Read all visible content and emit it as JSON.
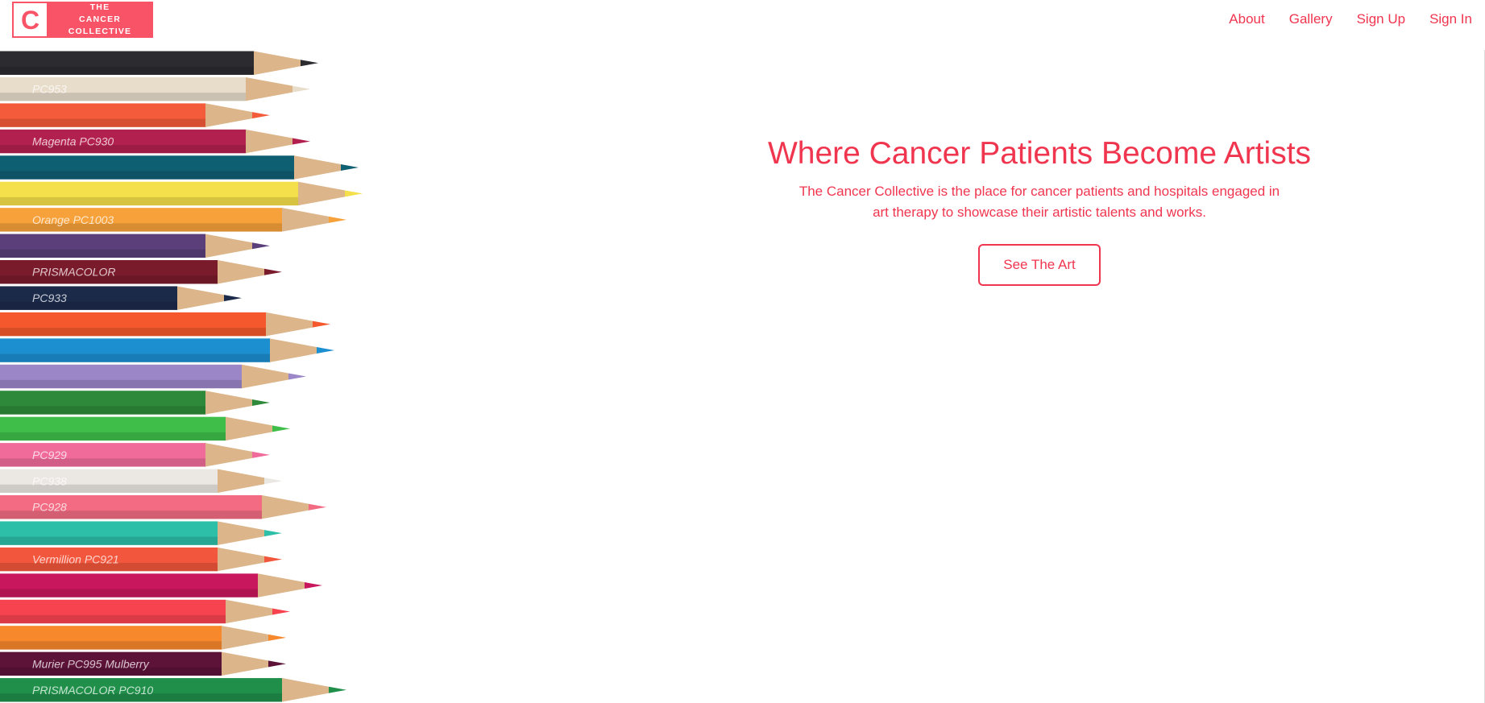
{
  "brand": {
    "mark": "C",
    "line1": "THE",
    "line2": "CANCER COLLECTIVE",
    "primary_color": "#f85367",
    "text_color": "#f0354f"
  },
  "nav": {
    "items": [
      {
        "label": "About"
      },
      {
        "label": "Gallery"
      },
      {
        "label": "Sign Up"
      },
      {
        "label": "Sign In"
      }
    ]
  },
  "hero": {
    "title": "Where Cancer Patients Become Artists",
    "subtitle": "The Cancer Collective is the place for cancer patients and hospitals engaged in art therapy to showcase their artistic talents and works.",
    "cta_label": "See The Art"
  },
  "pencils": {
    "image_icon": "colored-pencils-image",
    "items": [
      {
        "color": "#2b2b30",
        "label": ""
      },
      {
        "color": "#e8dccb",
        "label": "PC953"
      },
      {
        "color": "#f45b3a",
        "label": ""
      },
      {
        "color": "#b2204f",
        "label": "Magenta PC930"
      },
      {
        "color": "#0f5f73",
        "label": ""
      },
      {
        "color": "#f4e04a",
        "label": ""
      },
      {
        "color": "#f6a13a",
        "label": "Orange PC1003"
      },
      {
        "color": "#5b3f7a",
        "label": ""
      },
      {
        "color": "#7a1b2c",
        "label": "PRISMACOLOR"
      },
      {
        "color": "#1c2a4a",
        "label": "PC933"
      },
      {
        "color": "#f5582c",
        "label": ""
      },
      {
        "color": "#1c8fd0",
        "label": ""
      },
      {
        "color": "#9b86c8",
        "label": ""
      },
      {
        "color": "#2e8a3a",
        "label": ""
      },
      {
        "color": "#3fbf4a",
        "label": ""
      },
      {
        "color": "#f06b9a",
        "label": "PC929"
      },
      {
        "color": "#ebe7e2",
        "label": "PC938"
      },
      {
        "color": "#f26b82",
        "label": "PC928"
      },
      {
        "color": "#2dbfa8",
        "label": ""
      },
      {
        "color": "#f2563c",
        "label": "Vermillion PC921"
      },
      {
        "color": "#c8175c",
        "label": ""
      },
      {
        "color": "#f7424f",
        "label": ""
      },
      {
        "color": "#f7882c",
        "label": ""
      },
      {
        "color": "#5d1238",
        "label": "Murier PC995 Mulberry"
      },
      {
        "color": "#1f8f4a",
        "label": "PRISMACOLOR PC910"
      }
    ]
  }
}
